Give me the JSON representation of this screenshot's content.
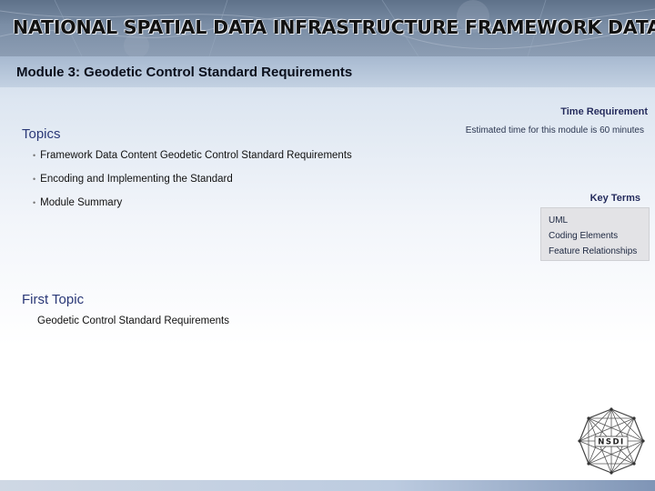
{
  "banner": {
    "title": "NATIONAL SPATIAL DATA INFRASTRUCTURE FRAMEWORK DATA"
  },
  "module": {
    "title": "Module 3: Geodetic Control  Standard Requirements"
  },
  "time": {
    "heading": "Time Requirement",
    "text": "Estimated time for this module is 60 minutes"
  },
  "topics": {
    "heading": "Topics",
    "items": [
      "Framework Data Content Geodetic Control Standard Requirements",
      "Encoding and Implementing the Standard",
      "Module Summary"
    ]
  },
  "key_terms": {
    "heading": "Key Terms",
    "items": [
      "UML",
      "Coding Elements",
      "Feature Relationships"
    ]
  },
  "first_topic": {
    "heading": "First Topic",
    "text": "Geodetic Control Standard Requirements"
  },
  "logo": {
    "text": "NSDI",
    "icon": "nsdi-network-logo"
  }
}
